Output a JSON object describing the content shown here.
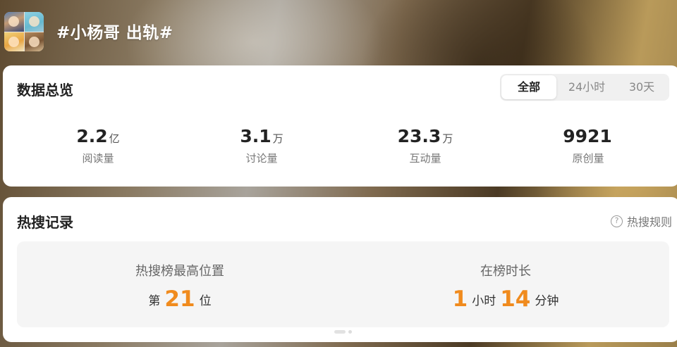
{
  "header": {
    "title": "#小杨哥 出轨#"
  },
  "overview": {
    "title": "数据总览",
    "tabs": [
      {
        "label": "全部",
        "active": true
      },
      {
        "label": "24小时",
        "active": false
      },
      {
        "label": "30天",
        "active": false
      }
    ],
    "stats": [
      {
        "value": "2.2",
        "unit": "亿",
        "label": "阅读量"
      },
      {
        "value": "3.1",
        "unit": "万",
        "label": "讨论量"
      },
      {
        "value": "23.3",
        "unit": "万",
        "label": "互动量"
      },
      {
        "value": "9921",
        "unit": "",
        "label": "原创量"
      }
    ]
  },
  "hot_search": {
    "title": "热搜记录",
    "rules_label": "热搜规则",
    "rules_icon": "question-circle-icon",
    "highest": {
      "label": "热搜榜最高位置",
      "prefix": "第",
      "value": "21",
      "suffix": "位"
    },
    "duration": {
      "label": "在榜时长",
      "hours": "1",
      "hours_unit": "小时",
      "minutes": "14",
      "minutes_unit": "分钟"
    }
  },
  "colors": {
    "accent": "#f08b1e",
    "card_bg": "#ffffff",
    "panel_bg": "#f5f5f5"
  }
}
